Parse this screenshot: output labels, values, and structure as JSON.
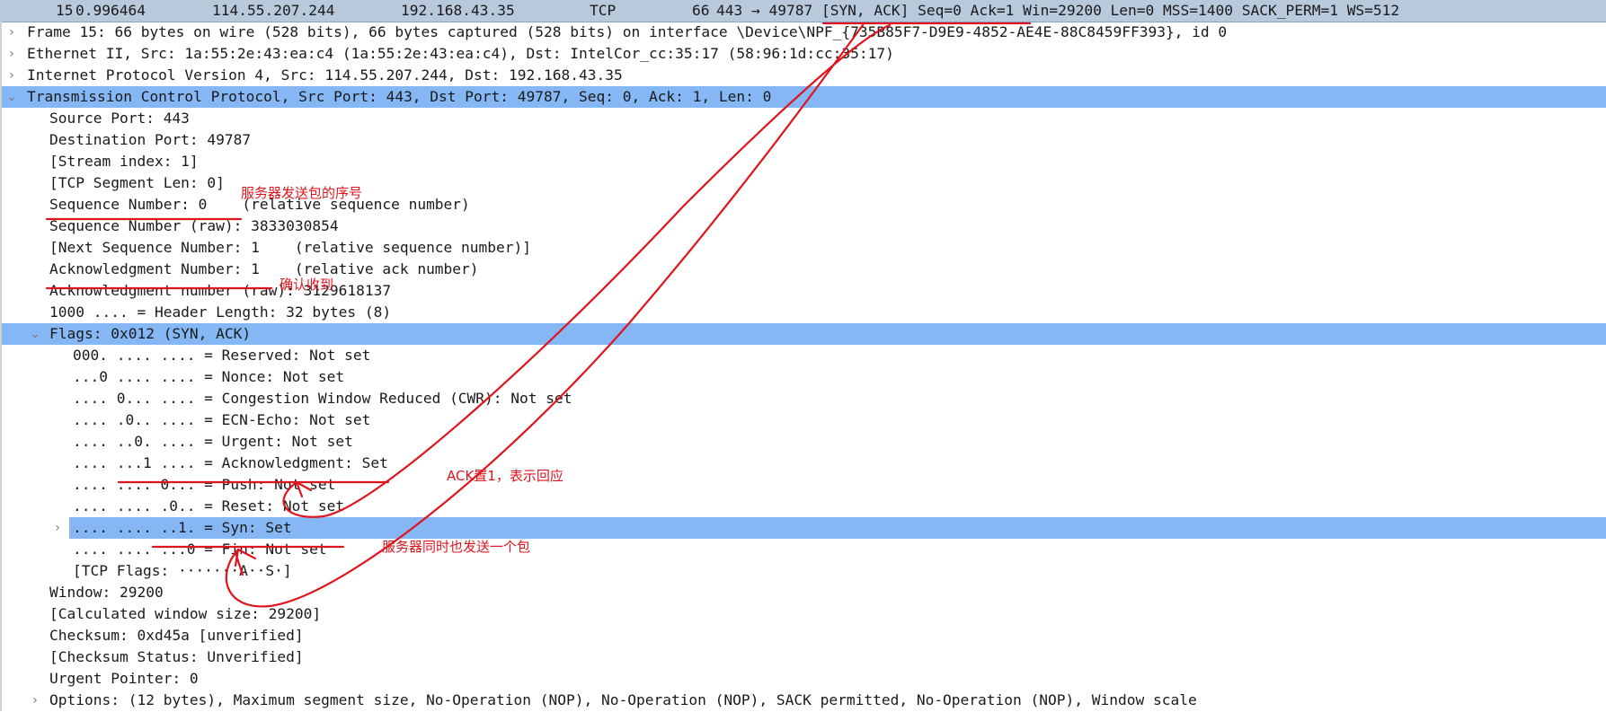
{
  "packet_list_row": {
    "no": "15",
    "time": "0.996464",
    "source": "114.55.207.244",
    "destination": "192.168.43.35",
    "protocol": "TCP",
    "length": "66",
    "info": "443 → 49787 [SYN, ACK] Seq=0 Ack=1 Win=29200 Len=0 MSS=1400 SACK_PERM=1 WS=512"
  },
  "tree": [
    {
      "text": "Frame 15: 66 bytes on wire (528 bits), 66 bytes captured (528 bits) on interface \\Device\\NPF_{735B85F7-D9E9-4852-AE4E-88C8459FF393}, id 0",
      "expander": "›"
    },
    {
      "text": "Ethernet II, Src: 1a:55:2e:43:ea:c4 (1a:55:2e:43:ea:c4), Dst: IntelCor_cc:35:17 (58:96:1d:cc:35:17)",
      "expander": "›"
    },
    {
      "text": "Internet Protocol Version 4, Src: 114.55.207.244, Dst: 192.168.43.35",
      "expander": "›"
    },
    {
      "text": "Transmission Control Protocol, Src Port: 443, Dst Port: 49787, Seq: 0, Ack: 1, Len: 0",
      "expander": "⌄"
    },
    {
      "text": "Source Port: 443"
    },
    {
      "text": "Destination Port: 49787"
    },
    {
      "text": "[Stream index: 1]"
    },
    {
      "text": "[TCP Segment Len: 0]"
    },
    {
      "text": "Sequence Number: 0    (relative sequence number)"
    },
    {
      "text": "Sequence Number (raw): 3833030854"
    },
    {
      "text": "[Next Sequence Number: 1    (relative sequence number)]"
    },
    {
      "text": "Acknowledgment Number: 1    (relative ack number)"
    },
    {
      "text": "Acknowledgment number (raw): 3129618137"
    },
    {
      "text": "1000 .... = Header Length: 32 bytes (8)"
    },
    {
      "text": "Flags: 0x012 (SYN, ACK)",
      "expander": "⌄"
    },
    {
      "text": "000. .... .... = Reserved: Not set"
    },
    {
      "text": "...0 .... .... = Nonce: Not set"
    },
    {
      "text": ".... 0... .... = Congestion Window Reduced (CWR): Not set"
    },
    {
      "text": ".... .0.. .... = ECN-Echo: Not set"
    },
    {
      "text": ".... ..0. .... = Urgent: Not set"
    },
    {
      "text": ".... ...1 .... = Acknowledgment: Set"
    },
    {
      "text": ".... .... 0... = Push: Not set"
    },
    {
      "text": ".... .... .0.. = Reset: Not set"
    },
    {
      "text": ".... .... ..1. = Syn: Set",
      "expander": "›"
    },
    {
      "text": ".... .... ...0 = Fin: Not set"
    },
    {
      "text": "[TCP Flags: ·······A··S·]"
    },
    {
      "text": "Window: 29200"
    },
    {
      "text": "[Calculated window size: 29200]"
    },
    {
      "text": "Checksum: 0xd45a [unverified]"
    },
    {
      "text": "[Checksum Status: Unverified]"
    },
    {
      "text": "Urgent Pointer: 0"
    },
    {
      "text": "Options: (12 bytes), Maximum segment size, No-Operation (NOP), No-Operation (NOP), SACK permitted, No-Operation (NOP), Window scale",
      "expander": "›"
    }
  ],
  "annotations": {
    "server_seq": "服务器发送包的序号",
    "ack_received": "确认收到",
    "ack_set": "ACK置1，表示回应",
    "server_sends": "服务器同时也发送一个包"
  },
  "colors": {
    "packet_row_bg": "#b9c9dc",
    "selection_bg": "#86b7f5",
    "annotation_red": "#e0141c"
  }
}
